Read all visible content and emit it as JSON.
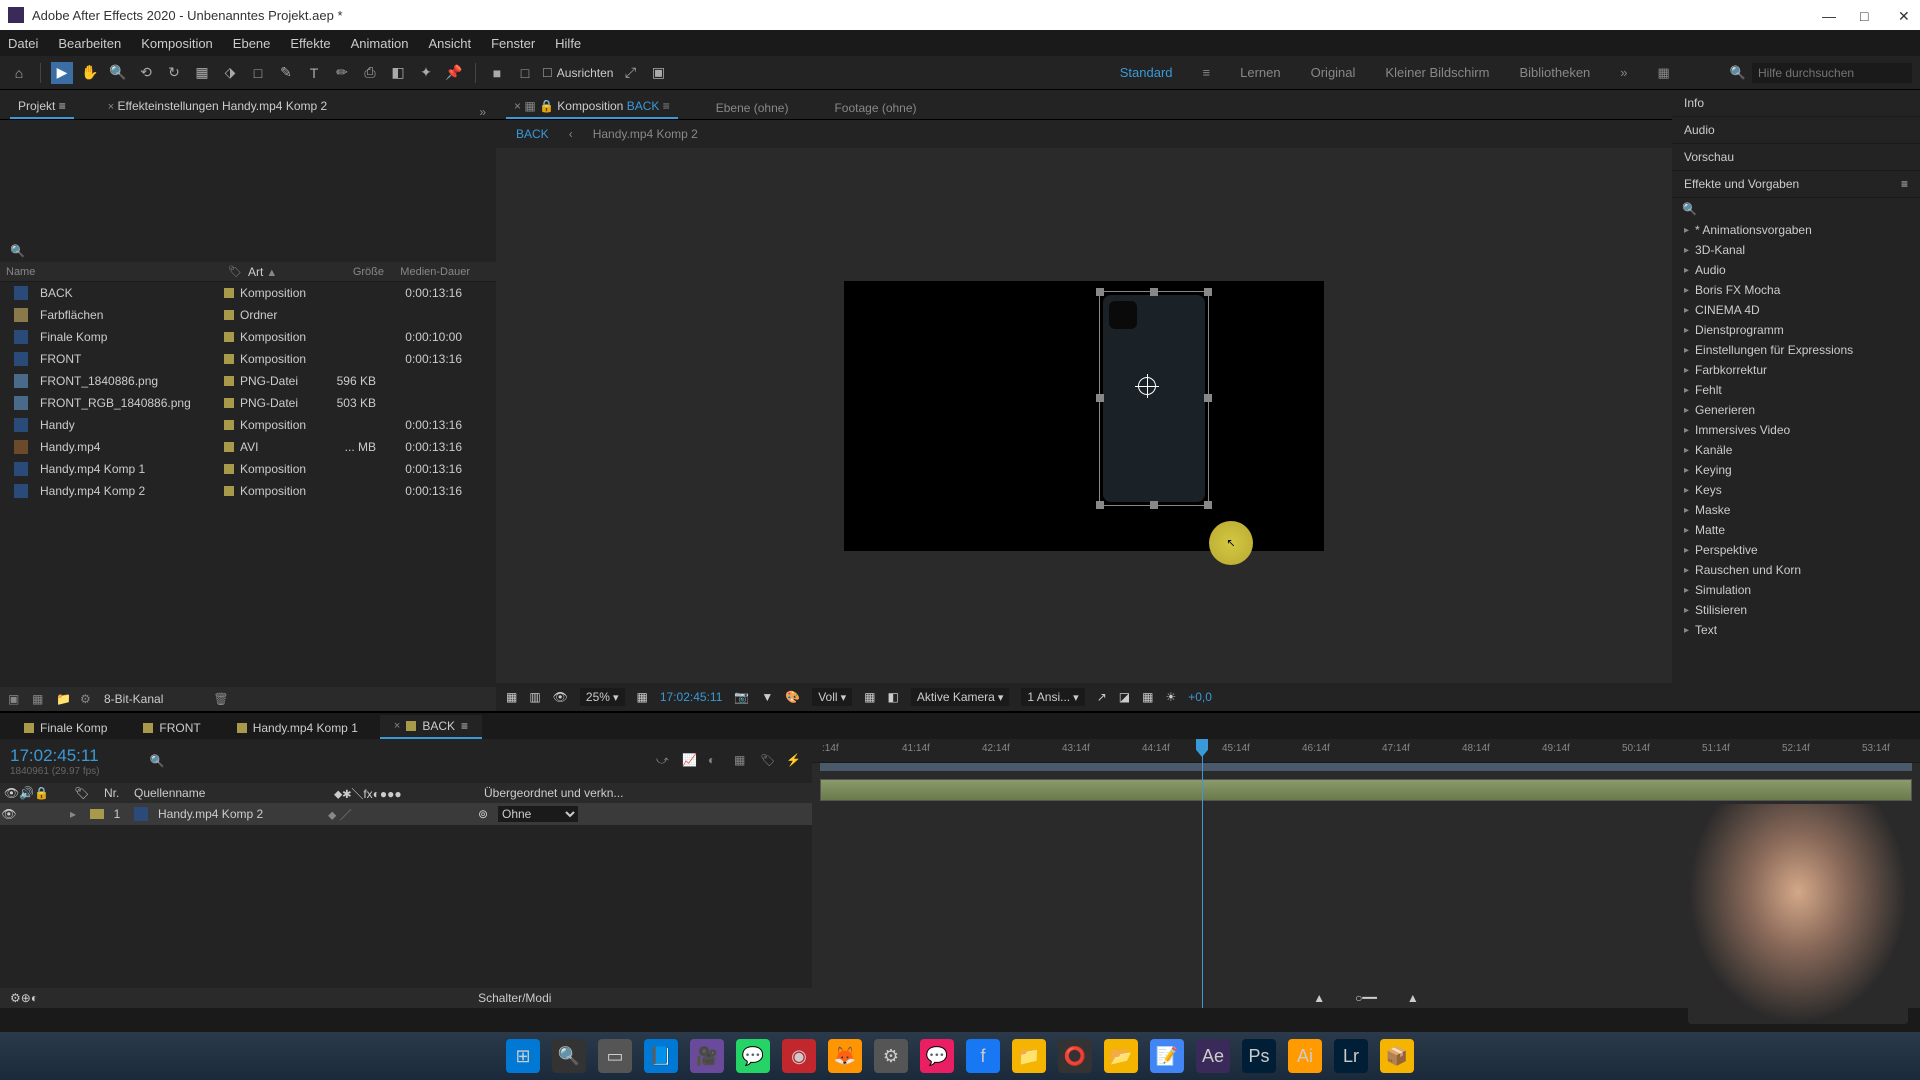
{
  "app": {
    "title": "Adobe After Effects 2020 - Unbenanntes Projekt.aep *"
  },
  "menu": [
    "Datei",
    "Bearbeiten",
    "Komposition",
    "Ebene",
    "Effekte",
    "Animation",
    "Ansicht",
    "Fenster",
    "Hilfe"
  ],
  "toolbar": {
    "align_label": "Ausrichten",
    "workspaces": [
      "Standard",
      "Lernen",
      "Original",
      "Kleiner Bildschirm",
      "Bibliotheken"
    ],
    "search_placeholder": "Hilfe durchsuchen"
  },
  "panels": {
    "project_tab": "Projekt",
    "effectsettings_tab": "Effekteinstellungen Handy.mp4 Komp 2",
    "comp_tab_prefix": "Komposition",
    "comp_tab_name": "BACK",
    "ebene_tab": "Ebene (ohne)",
    "footage_tab": "Footage (ohne)",
    "breadcrumb_back": "BACK",
    "breadcrumb_sub": "Handy.mp4 Komp 2"
  },
  "project": {
    "cols": {
      "name": "Name",
      "art": "Art",
      "size": "Größe",
      "dur": "Medien-Dauer"
    },
    "items": [
      {
        "name": "BACK",
        "icon": "comp",
        "art": "Komposition",
        "size": "",
        "dur": "0:00:13:16"
      },
      {
        "name": "Farbflächen",
        "icon": "folder",
        "art": "Ordner",
        "size": "",
        "dur": ""
      },
      {
        "name": "Finale Komp",
        "icon": "comp",
        "art": "Komposition",
        "size": "",
        "dur": "0:00:10:00"
      },
      {
        "name": "FRONT",
        "icon": "comp",
        "art": "Komposition",
        "size": "",
        "dur": "0:00:13:16"
      },
      {
        "name": "FRONT_1840886.png",
        "icon": "png",
        "art": "PNG-Datei",
        "size": "596 KB",
        "dur": ""
      },
      {
        "name": "FRONT_RGB_1840886.png",
        "icon": "png",
        "art": "PNG-Datei",
        "size": "503 KB",
        "dur": ""
      },
      {
        "name": "Handy",
        "icon": "comp",
        "art": "Komposition",
        "size": "",
        "dur": "0:00:13:16"
      },
      {
        "name": "Handy.mp4",
        "icon": "avi",
        "art": "AVI",
        "size": "... MB",
        "dur": "0:00:13:16"
      },
      {
        "name": "Handy.mp4 Komp 1",
        "icon": "comp",
        "art": "Komposition",
        "size": "",
        "dur": "0:00:13:16"
      },
      {
        "name": "Handy.mp4 Komp 2",
        "icon": "comp",
        "art": "Komposition",
        "size": "",
        "dur": "0:00:13:16"
      }
    ],
    "footer_depth": "8-Bit-Kanal"
  },
  "preview": {
    "zoom": "25%",
    "timecode": "17:02:45:11",
    "quality": "Voll",
    "camera": "Aktive Kamera",
    "views": "1 Ansi...",
    "offset": "+0,0"
  },
  "right": {
    "info": "Info",
    "audio": "Audio",
    "vorschau": "Vorschau",
    "effects": "Effekte und Vorgaben",
    "cats": [
      "* Animationsvorgaben",
      "3D-Kanal",
      "Audio",
      "Boris FX Mocha",
      "CINEMA 4D",
      "Dienstprogramm",
      "Einstellungen für Expressions",
      "Farbkorrektur",
      "Fehlt",
      "Generieren",
      "Immersives Video",
      "Kanäle",
      "Keying",
      "Keys",
      "Maske",
      "Matte",
      "Perspektive",
      "Rauschen und Korn",
      "Simulation",
      "Stilisieren",
      "Text"
    ]
  },
  "timeline": {
    "tabs": [
      {
        "label": "Finale Komp",
        "active": false
      },
      {
        "label": "FRONT",
        "active": false
      },
      {
        "label": "Handy.mp4 Komp 1",
        "active": false
      },
      {
        "label": "BACK",
        "active": true
      }
    ],
    "timecode": "17:02:45:11",
    "subinfo": "1840961 (29.97 fps)",
    "col_nr": "Nr.",
    "col_source": "Quellenname",
    "col_parent": "Übergeordnet und verkn...",
    "layer": {
      "num": "1",
      "name": "Handy.mp4 Komp 2",
      "parent": "Ohne"
    },
    "ruler": [
      ":14f",
      "41:14f",
      "42:14f",
      "43:14f",
      "44:14f",
      "45:14f",
      "46:14f",
      "47:14f",
      "48:14f",
      "49:14f",
      "50:14f",
      "51:14f",
      "52:14f",
      "53:14f"
    ],
    "footer_modes": "Schalter/Modi"
  },
  "taskbar": {
    "icons": [
      "⊞",
      "🔍",
      "▭",
      "📘",
      "🎥",
      "💬",
      "◉",
      "🦊",
      "⚙",
      "💬",
      "f",
      "📁",
      "⭕",
      "📂",
      "📝",
      "Ae",
      "Ps",
      "Ai",
      "Lr",
      "📦"
    ]
  }
}
